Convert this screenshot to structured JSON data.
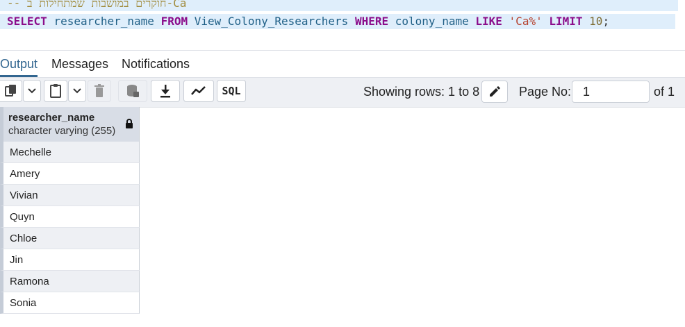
{
  "editor": {
    "comment_line": "-- חוקרים במושבות שמתחילות ב-Ca",
    "query": {
      "kw_select": "SELECT",
      "col": "researcher_name",
      "kw_from": "FROM",
      "view": "View_Colony_Researchers",
      "kw_where": "WHERE",
      "where_col": "colony_name",
      "kw_like": "LIKE",
      "pattern": "'Ca%'",
      "kw_limit": "LIMIT",
      "limit_value": "10",
      "terminator": ";"
    }
  },
  "tabs": [
    {
      "label": "Output",
      "active": true
    },
    {
      "label": "Messages",
      "active": false
    },
    {
      "label": "Notifications",
      "active": false
    }
  ],
  "toolbar": {
    "sql_label": "SQL",
    "rows_text": "Showing rows: 1 to 8",
    "page_no_label": "Page No:",
    "page_value": "1",
    "of_text": "of 1"
  },
  "grid": {
    "column": {
      "name": "researcher_name",
      "type": "character varying (255)"
    },
    "rows": [
      "Mechelle",
      "Amery",
      "Vivian",
      "Quyn",
      "Chloe",
      "Jin",
      "Ramona",
      "Sonia"
    ]
  },
  "colors": {
    "accent": "#326690",
    "keyword": "#8b0d8b",
    "identifier": "#1f5f86",
    "string": "#b5422e"
  }
}
